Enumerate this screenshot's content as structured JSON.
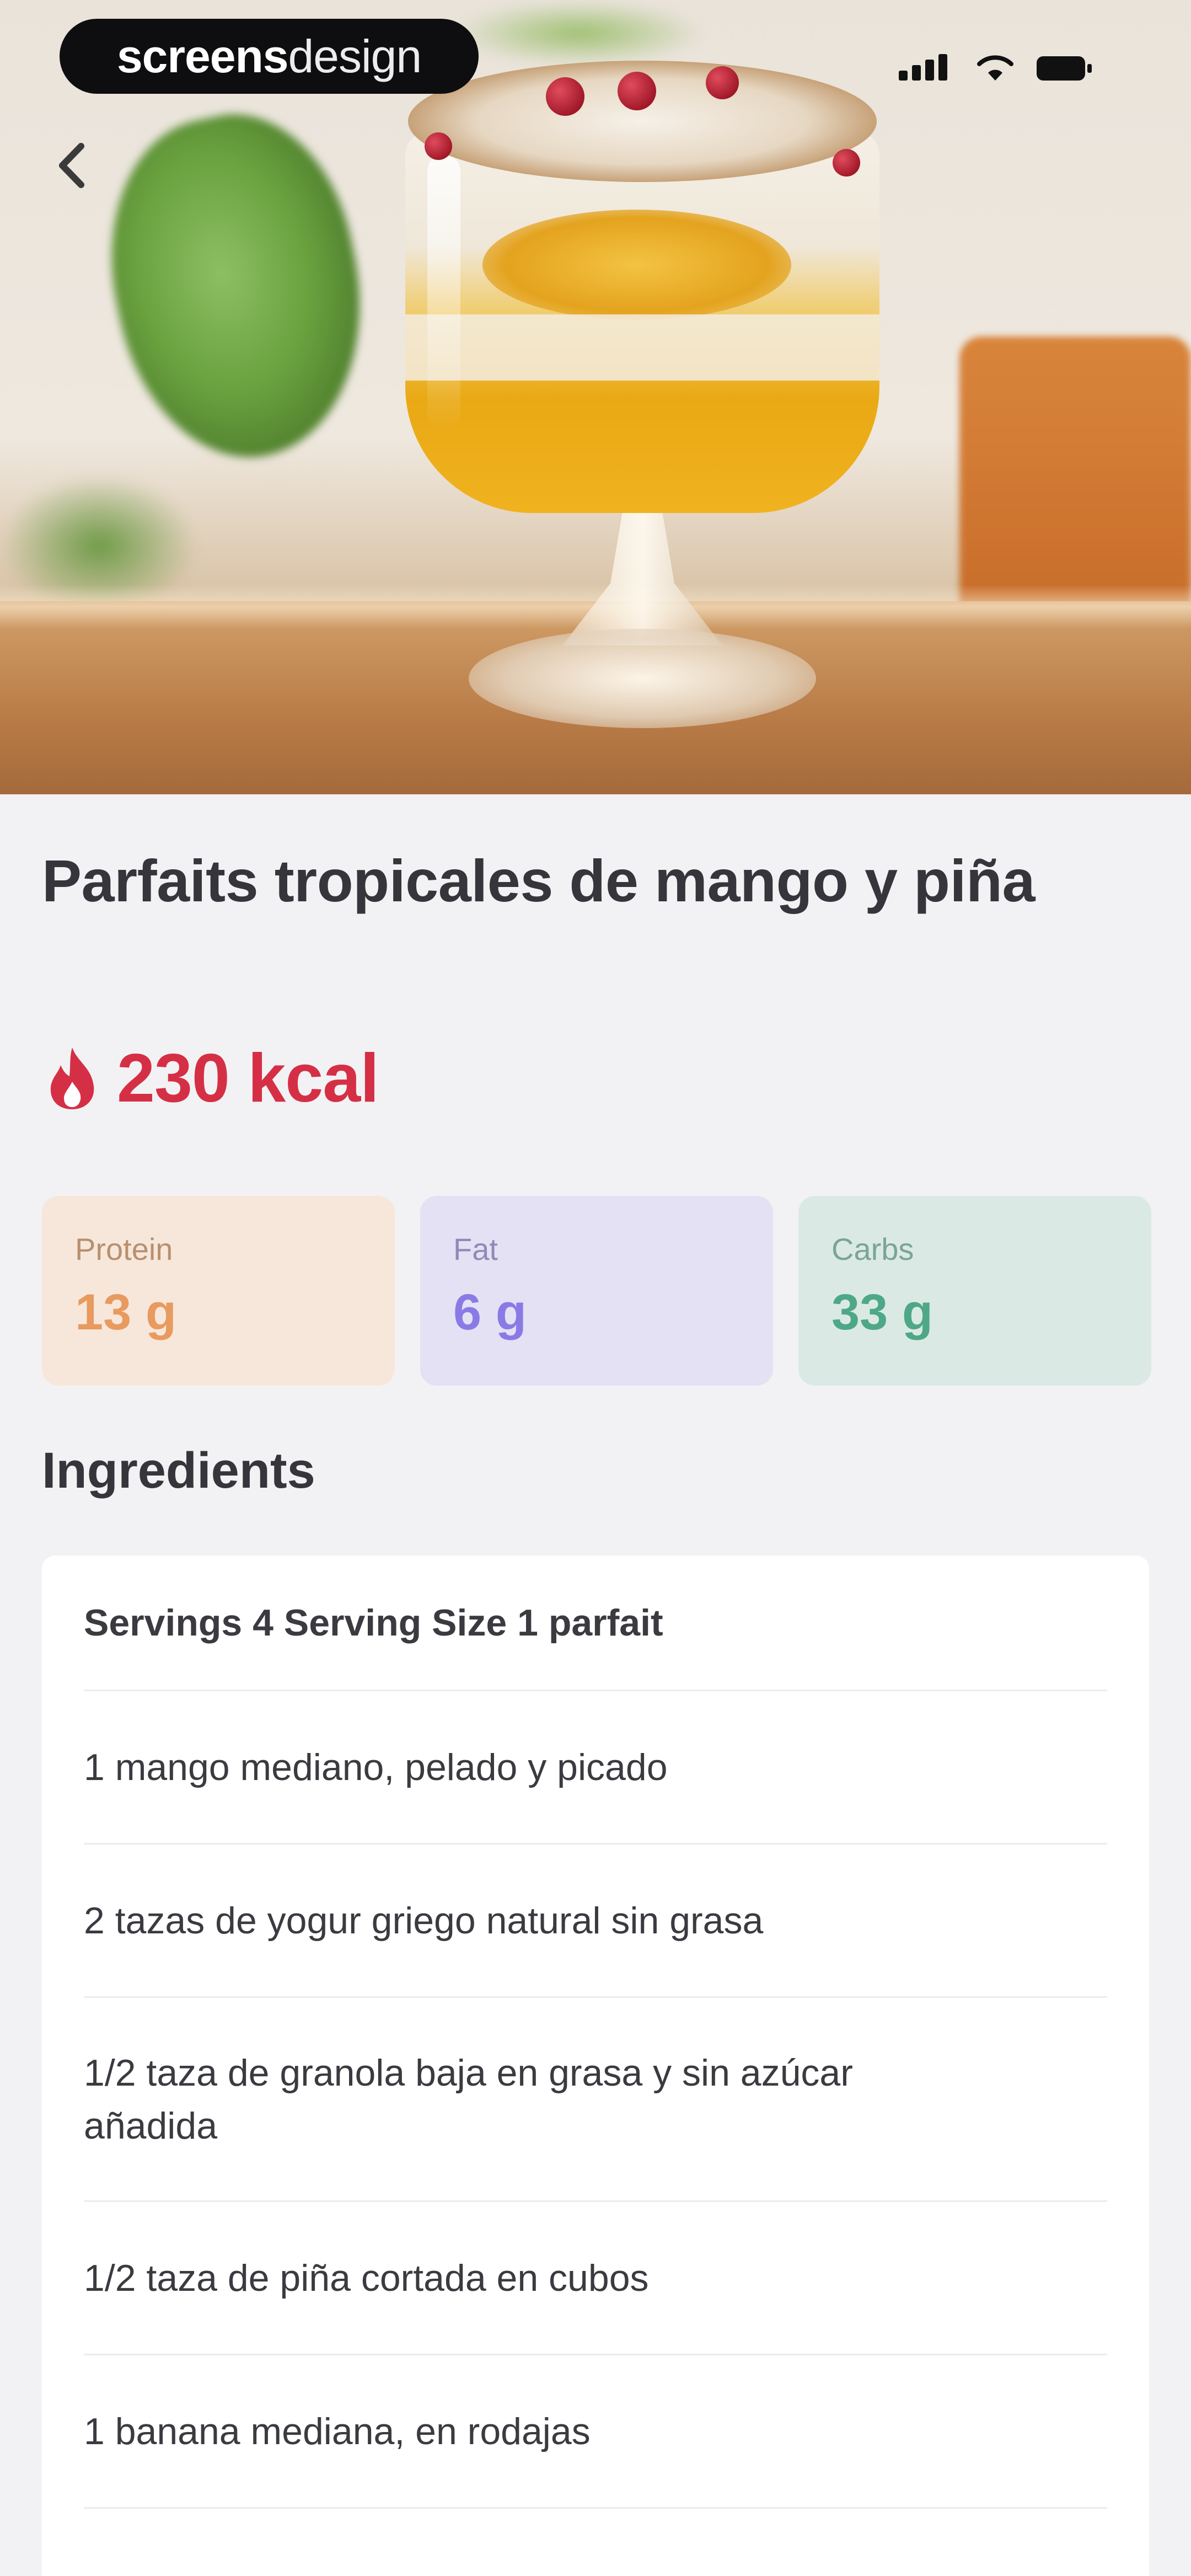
{
  "status_bar": {
    "brand_bold": "screens",
    "brand_light": "design"
  },
  "recipe": {
    "title": "Parfaits tropicales de mango y piña",
    "calories": "230 kcal"
  },
  "macros": {
    "protein": {
      "label": "Protein",
      "value": "13 g"
    },
    "fat": {
      "label": "Fat",
      "value": "6 g"
    },
    "carbs": {
      "label": "Carbs",
      "value": "33 g"
    }
  },
  "ingredients": {
    "heading": "Ingredients",
    "servings": "Servings 4 Serving Size 1 parfait",
    "items": [
      "1 mango mediano, pelado y picado",
      "2 tazas de yogur griego natural sin grasa",
      "1/2 taza de granola baja en grasa y sin azúcar añadida",
      "1/2 taza de piña cortada en cubos",
      "1 banana mediana, en rodajas"
    ]
  },
  "colors": {
    "accent_calories": "#d52f46",
    "protein_bg": "#f7e7db",
    "fat_bg": "#e3e1f3",
    "carbs_bg": "#dbe9e4"
  },
  "icons": {
    "back": "chevron-left-icon",
    "calories": "flame-icon",
    "signal": "cellular-signal-icon",
    "wifi": "wifi-icon",
    "battery": "battery-icon"
  }
}
